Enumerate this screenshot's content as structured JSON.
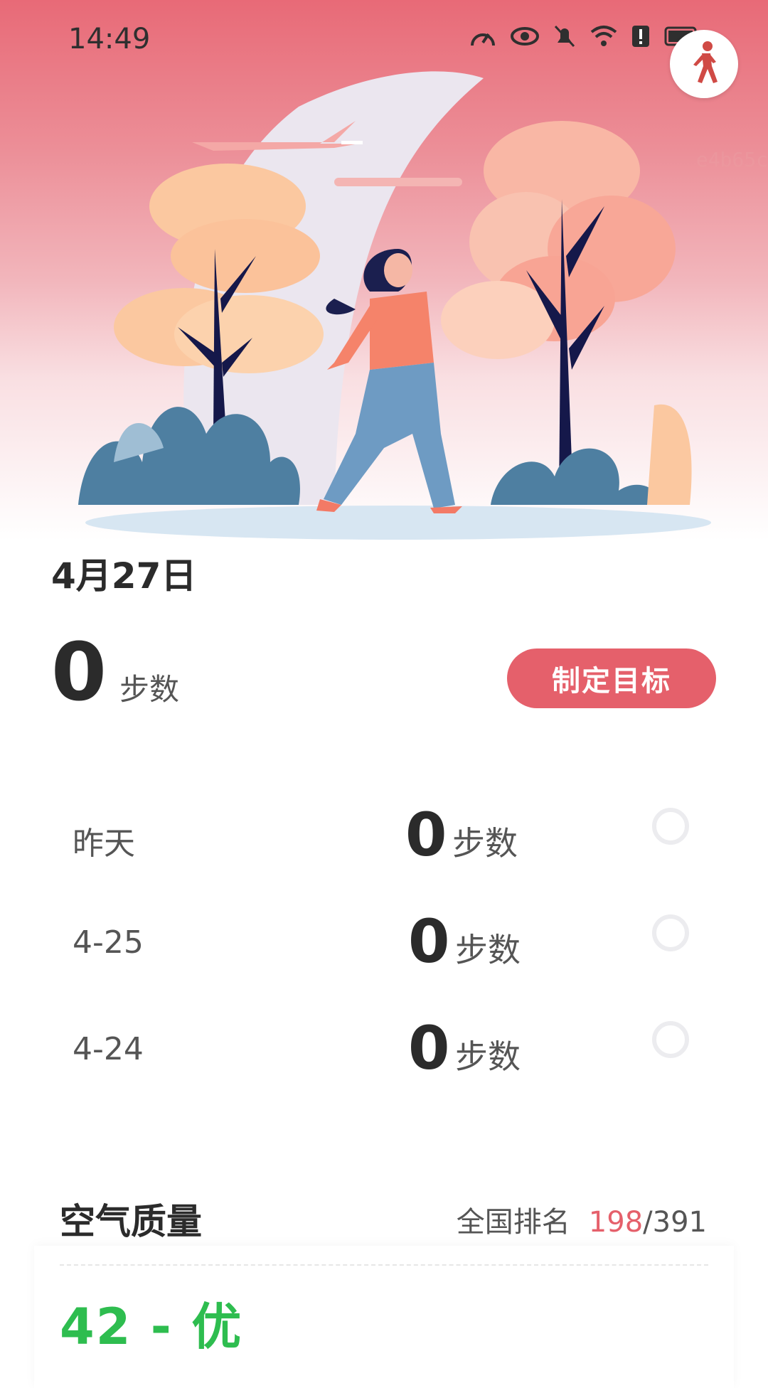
{
  "status_bar": {
    "time": "14:49",
    "icons": [
      "speedometer-icon",
      "eye-icon",
      "bell-off-icon",
      "wifi-icon",
      "alert-icon",
      "battery-icon"
    ]
  },
  "hero": {
    "watermark": "e4b65c",
    "badge_icon": "walking-person-icon",
    "colors": {
      "top": "#e86a77",
      "bottom": "#ffffff",
      "accent": "#e5606b"
    }
  },
  "today": {
    "date": "4月27日",
    "steps": "0",
    "unit": "步数",
    "goal_button": "制定目标"
  },
  "history": [
    {
      "label": "昨天",
      "steps": "0",
      "unit": "步数"
    },
    {
      "label": "4-25",
      "steps": "0",
      "unit": "步数"
    },
    {
      "label": "4-24",
      "steps": "0",
      "unit": "步数"
    }
  ],
  "air_quality": {
    "title": "空气质量",
    "rank_label": "全国排名",
    "rank": "198",
    "rank_sep": "/",
    "rank_total": "391",
    "aqi_text": "42 - 优",
    "aqi_color": "#2ebd4f"
  }
}
